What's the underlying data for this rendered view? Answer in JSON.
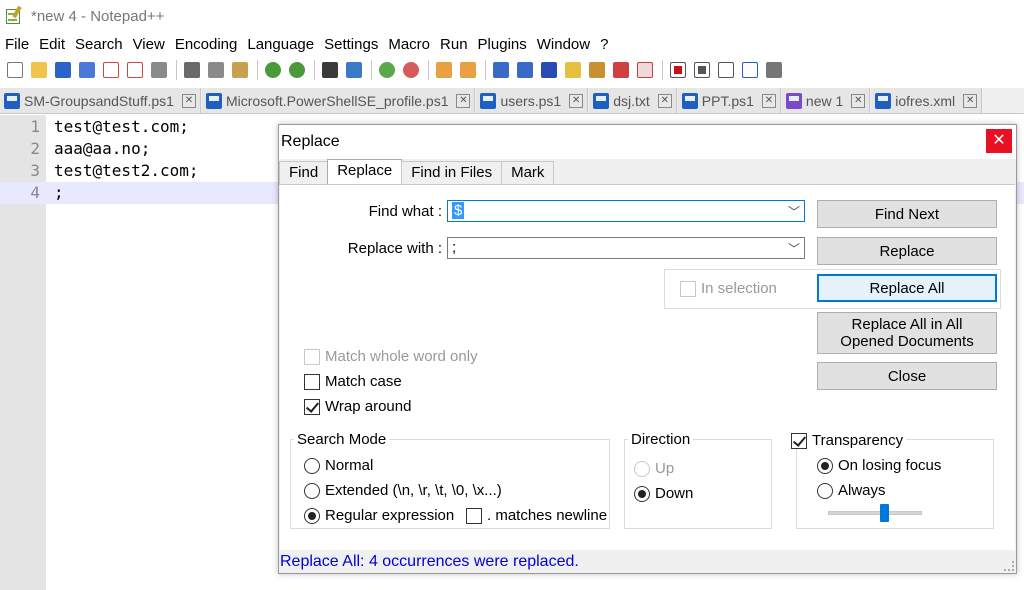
{
  "window": {
    "title": "*new 4 - Notepad++"
  },
  "menu": [
    "File",
    "Edit",
    "Search",
    "View",
    "Encoding",
    "Language",
    "Settings",
    "Macro",
    "Run",
    "Plugins",
    "Window",
    "?"
  ],
  "tabs": [
    {
      "label": "SM-GroupsandStuff.ps1",
      "active": false
    },
    {
      "label": "Microsoft.PowerShellSE_profile.ps1",
      "active": false
    },
    {
      "label": "users.ps1",
      "active": false
    },
    {
      "label": "dsj.txt",
      "active": false
    },
    {
      "label": "PPT.ps1",
      "active": false
    },
    {
      "label": "new 1",
      "active": false
    },
    {
      "label": "iofres.xml",
      "active": false
    }
  ],
  "editor": {
    "lines": [
      {
        "num": "1",
        "text": "test@test.com;"
      },
      {
        "num": "2",
        "text": "aaa@aa.no;"
      },
      {
        "num": "3",
        "text": "test@test2.com;"
      },
      {
        "num": "4",
        "text": ";"
      }
    ]
  },
  "dialog": {
    "title": "Replace",
    "close_glyph": "✕",
    "tabs": [
      "Find",
      "Replace",
      "Find in Files",
      "Mark"
    ],
    "active_tab": "Replace",
    "find_label": "Find what :",
    "find_value": "$",
    "replace_label": "Replace with :",
    "replace_value": ";",
    "in_selection": "In selection",
    "buttons": {
      "find_next": "Find Next",
      "replace": "Replace",
      "replace_all": "Replace All",
      "replace_all_opened": "Replace All in All Opened Documents",
      "close": "Close"
    },
    "options": {
      "whole_word": {
        "label": "Match whole word only",
        "checked": false,
        "enabled": false
      },
      "match_case": {
        "label": "Match case",
        "checked": false,
        "enabled": true
      },
      "wrap_around": {
        "label": "Wrap around",
        "checked": true,
        "enabled": true
      }
    },
    "search_mode": {
      "title": "Search Mode",
      "normal": "Normal",
      "extended": "Extended (\\n, \\r, \\t, \\0, \\x...)",
      "regex": "Regular expression",
      "matches_newline": ". matches newline",
      "selected": "regex"
    },
    "direction": {
      "title": "Direction",
      "up": "Up",
      "down": "Down",
      "selected": "down"
    },
    "transparency": {
      "label": "Transparency",
      "checked": true,
      "on_losing_focus": "On losing focus",
      "always": "Always",
      "selected": "on_losing_focus",
      "slider_level": 0.6
    },
    "status": "Replace All: 4 occurrences were replaced."
  },
  "colors": {
    "status_text": "#0000d8",
    "close_button": "#e81123",
    "current_line": "#e8e8ff",
    "selection": "#3399ff"
  },
  "toolbar_icons": [
    "new-file-icon",
    "open-file-icon",
    "save-icon",
    "save-all-icon",
    "close-icon",
    "close-all-icon",
    "print-icon",
    "cut-icon",
    "copy-icon",
    "paste-icon",
    "undo-icon",
    "redo-icon",
    "find-icon",
    "replace-icon",
    "zoom-in-icon",
    "zoom-out-icon",
    "sync-vertical-icon",
    "sync-horizontal-icon",
    "word-wrap-icon",
    "show-all-chars-icon",
    "indent-guide-icon",
    "doc-map-icon",
    "function-list-icon",
    "folder-workspace-icon",
    "monitoring-icon",
    "record-macro-icon",
    "stop-macro-icon",
    "play-macro-icon",
    "run-macro-multiple-icon",
    "save-macro-icon"
  ]
}
